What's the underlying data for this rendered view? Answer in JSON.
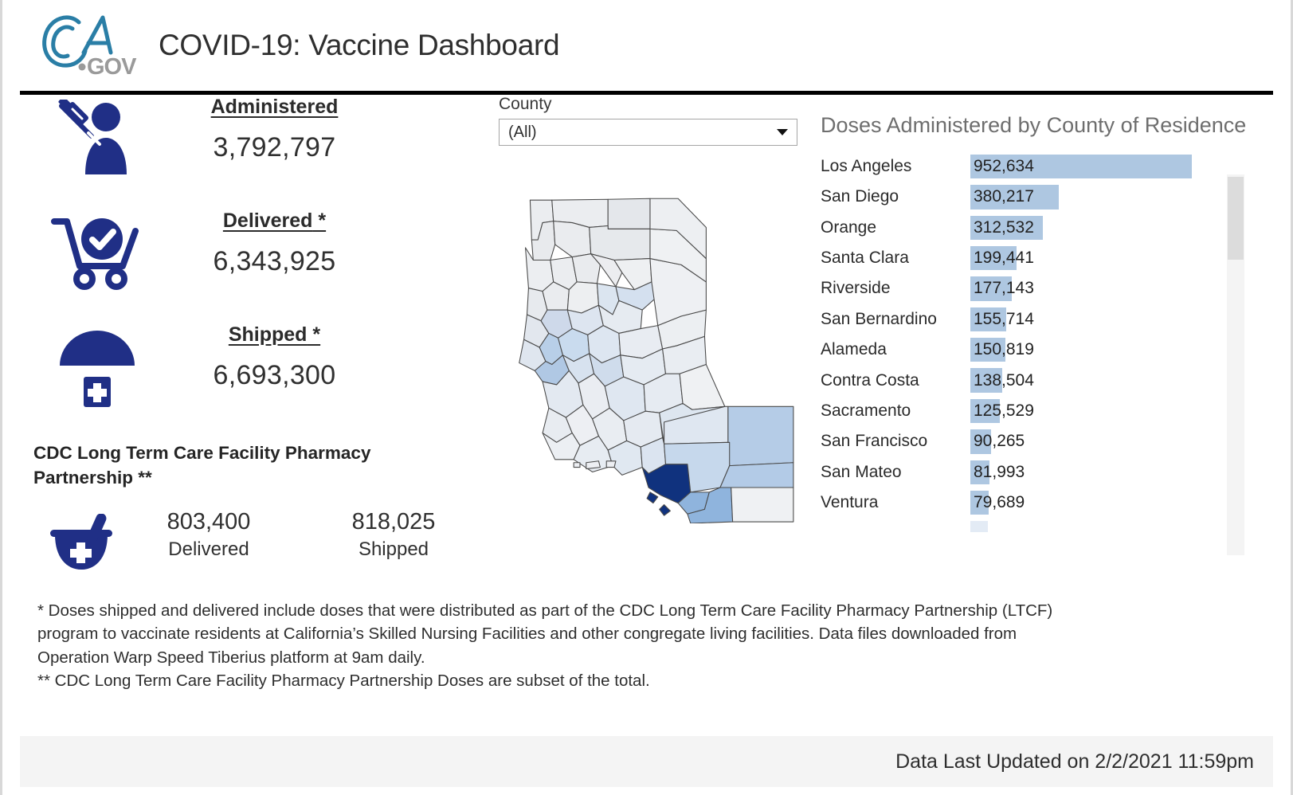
{
  "header": {
    "logo_primary": "CA",
    "logo_secondary": ".GOV",
    "title": "COVID-19: Vaccine Dashboard"
  },
  "stats": [
    {
      "icon": "syringe-person-icon",
      "label": "Administered",
      "asterisk": "",
      "value": "3,792,797"
    },
    {
      "icon": "cart-check-icon",
      "label": "Delivered",
      "asterisk": " *",
      "value": "6,343,925"
    },
    {
      "icon": "parachute-medical-icon",
      "label": "Shipped",
      "asterisk": " *",
      "value": "6,693,300"
    }
  ],
  "ltcf": {
    "heading": "CDC Long Term Care Facility Pharmacy Partnership **",
    "icon": "mortar-pestle-icon",
    "delivered_value": "803,400",
    "delivered_label": "Delivered",
    "shipped_value": "818,025",
    "shipped_label": "Shipped"
  },
  "filter": {
    "label": "County",
    "selected": "(All)",
    "options": [
      "(All)"
    ]
  },
  "map": {
    "title": "California counties choropleth",
    "highlight_county": "Los Angeles",
    "highlight_color": "#10327e",
    "base_color": "#e8eaed",
    "stroke_color": "#4a4a4a"
  },
  "chart_data": {
    "type": "bar",
    "orientation": "horizontal",
    "title": "Doses Administered by County of Residence",
    "xlabel": "",
    "ylabel": "",
    "grid": false,
    "legend": null,
    "value_labels": true,
    "axis_max": 952634,
    "bar_color": "#aec7e1",
    "categories": [
      "Los Angeles",
      "San Diego",
      "Orange",
      "Santa Clara",
      "Riverside",
      "San Bernardino",
      "Alameda",
      "Contra Costa",
      "Sacramento",
      "San Francisco",
      "San Mateo",
      "Ventura"
    ],
    "values": [
      952634,
      380217,
      312532,
      199441,
      177143,
      155714,
      150819,
      138504,
      125529,
      90265,
      81993,
      79689
    ],
    "value_text": [
      "952,634",
      "380,217",
      "312,532",
      "199,441",
      "177,143",
      "155,714",
      "150,819",
      "138,504",
      "125,529",
      "90,265",
      "81,993",
      "79,689"
    ],
    "scrollable": true,
    "visible_rows": 12
  },
  "footnotes": {
    "line1": "* Doses shipped and delivered include doses that were distributed as part of the CDC Long Term Care Facility Pharmacy Partnership (LTCF)",
    "line2": "program to vaccinate residents at California’s Skilled Nursing Facilities and other congregate living facilities.  Data files downloaded from",
    "line3": "Operation Warp Speed Tiberius platform at 9am daily.",
    "line4": "** CDC Long Term Care Facility Pharmacy Partnership Doses are subset of the total."
  },
  "footer": {
    "updated_text": "Data Last Updated on 2/2/2021 11:59pm"
  }
}
